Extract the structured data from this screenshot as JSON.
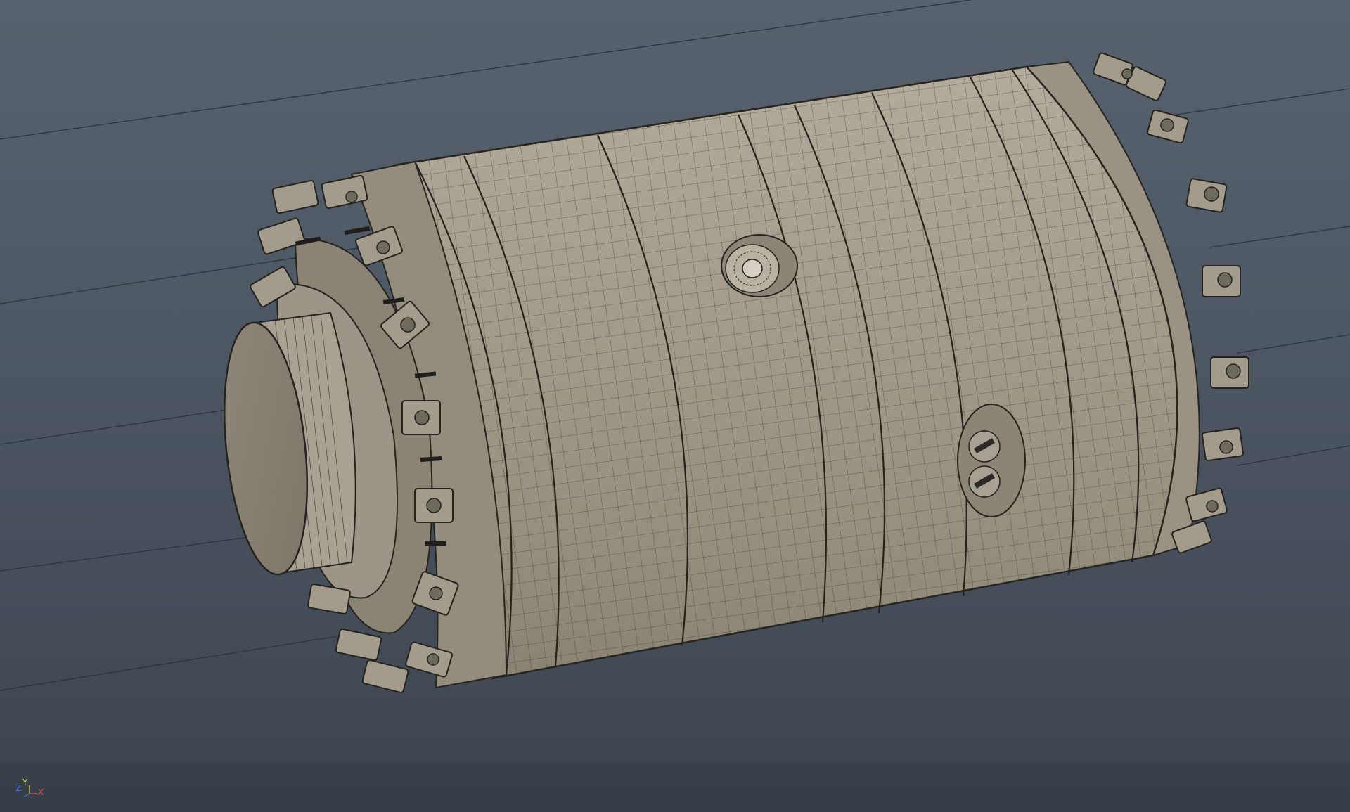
{
  "viewport": {
    "axis_gizmo": {
      "y_label": "Y",
      "z_label": "Z",
      "x_label": "X",
      "y_color": "#c8d040",
      "z_color": "#3c6fe0",
      "x_color": "#e04a3c"
    },
    "colors": {
      "background": "#4d5663",
      "model_surface": "#a39a8a",
      "wireframe": "#2b2a26",
      "reference_lines": "#2d343d"
    },
    "icons": {
      "model": "cylindrical-mechanical-part",
      "gizmo": "axis-orientation-gizmo"
    }
  }
}
